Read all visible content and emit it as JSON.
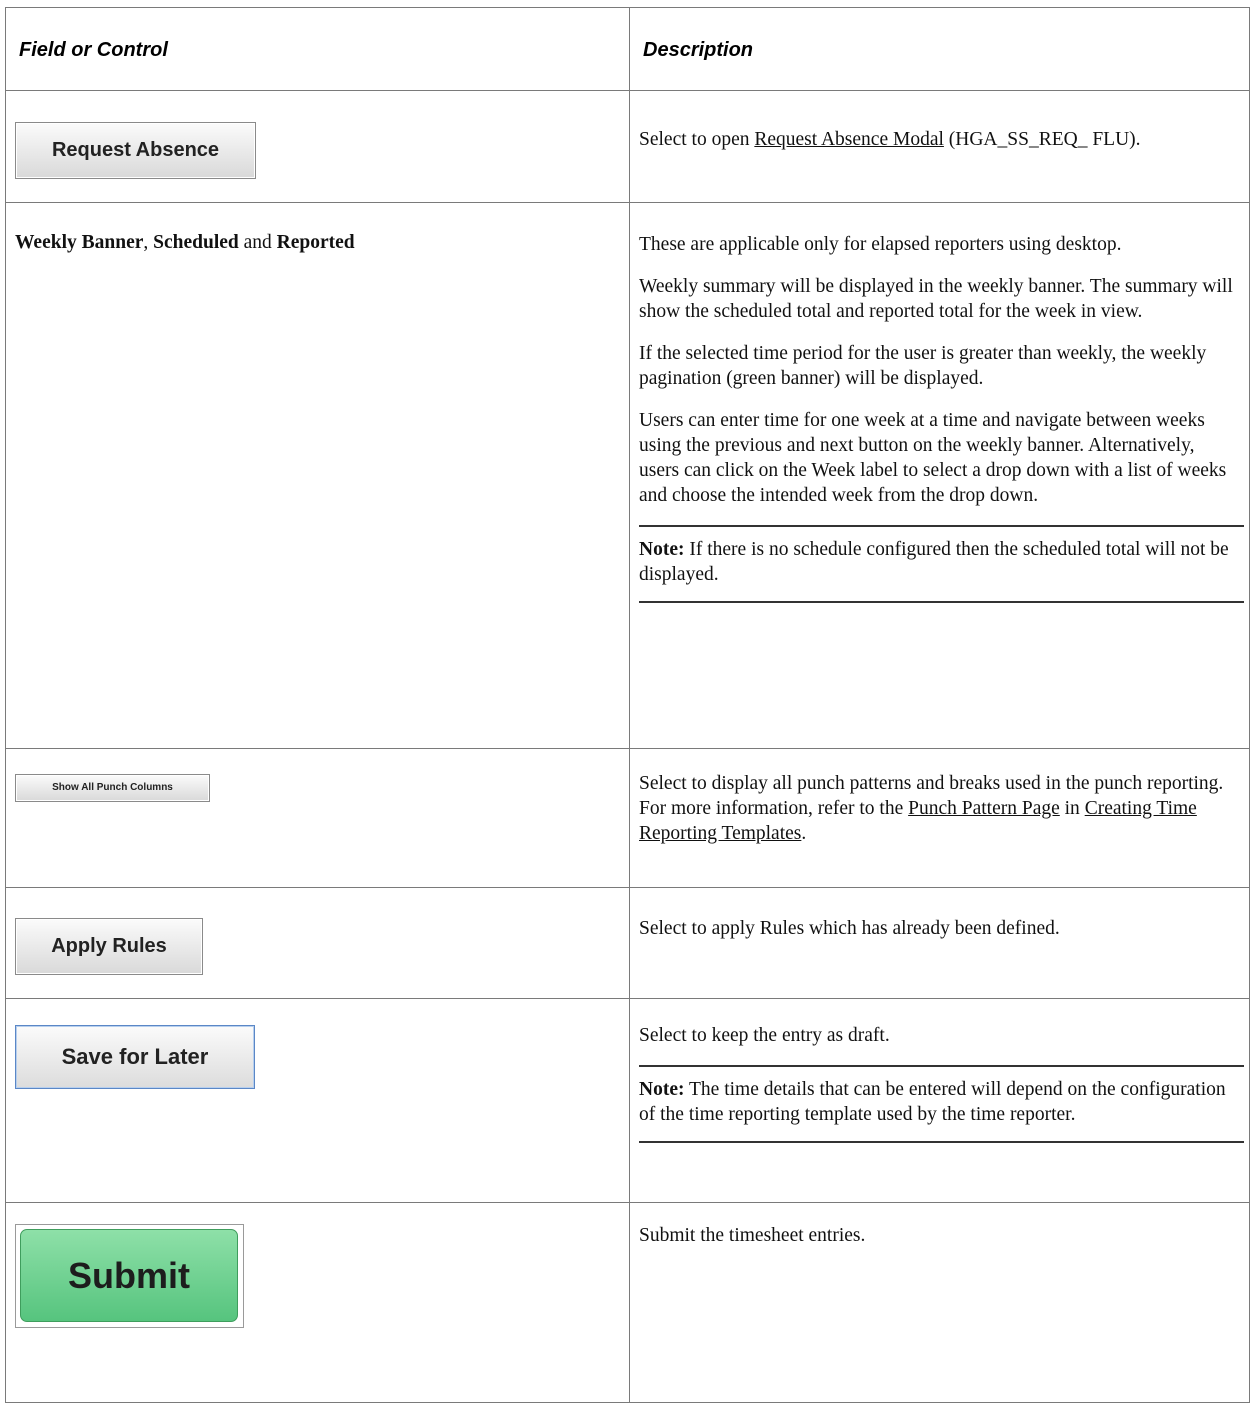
{
  "table": {
    "header": {
      "field_col": "Field or Control",
      "desc_col": "Description"
    },
    "rows": [
      {
        "control": {
          "type": "button",
          "label": "Request Absence"
        },
        "description": {
          "p1_before_link": "Select to open ",
          "p1_link": "Request Absence Modal",
          "p1_after_link": " (HGA_SS_REQ_ FLU)."
        }
      },
      {
        "control": {
          "type": "text",
          "part1": "Weekly Banner",
          "sep1": ", ",
          "part2": "Scheduled",
          "sep2": " and ",
          "part3": "Reported"
        },
        "description": {
          "p1": "These are applicable only for elapsed reporters using desktop.",
          "p2": "Weekly summary will be displayed in the weekly banner. The summary will show the scheduled total and reported total for the week in view.",
          "p3": "If the selected time period for the user is greater than weekly,  the weekly pagination (green banner) will be displayed.",
          "p4": "Users can enter time for one week at a time and navigate between weeks using the previous and next button on the weekly banner. Alternatively, users can click on the Week label to select a drop down with a list of weeks and choose the intended week from the drop down.",
          "note_label": "Note:",
          "note_text": " If there is no schedule configured then the scheduled total will not be displayed."
        }
      },
      {
        "control": {
          "type": "button",
          "label": "Show All Punch Columns"
        },
        "description": {
          "before": "Select to display all punch patterns and breaks used in the punch reporting. For more information, refer to the ",
          "link1": "Punch Pattern Page",
          "mid": " in ",
          "link2": "Creating Time Reporting Templates",
          "after": "."
        }
      },
      {
        "control": {
          "type": "button",
          "label": "Apply Rules"
        },
        "description": {
          "p1": "Select to apply Rules which has already been defined."
        }
      },
      {
        "control": {
          "type": "button",
          "label": "Save for Later"
        },
        "description": {
          "p1": "Select to keep the entry as draft.",
          "note_label": "Note:",
          "note_text": " The time details that can be entered will depend on the configuration of the time reporting template used by the time reporter."
        }
      },
      {
        "control": {
          "type": "button",
          "label": "Submit"
        },
        "description": {
          "p1": "Submit the timesheet entries."
        }
      }
    ]
  }
}
